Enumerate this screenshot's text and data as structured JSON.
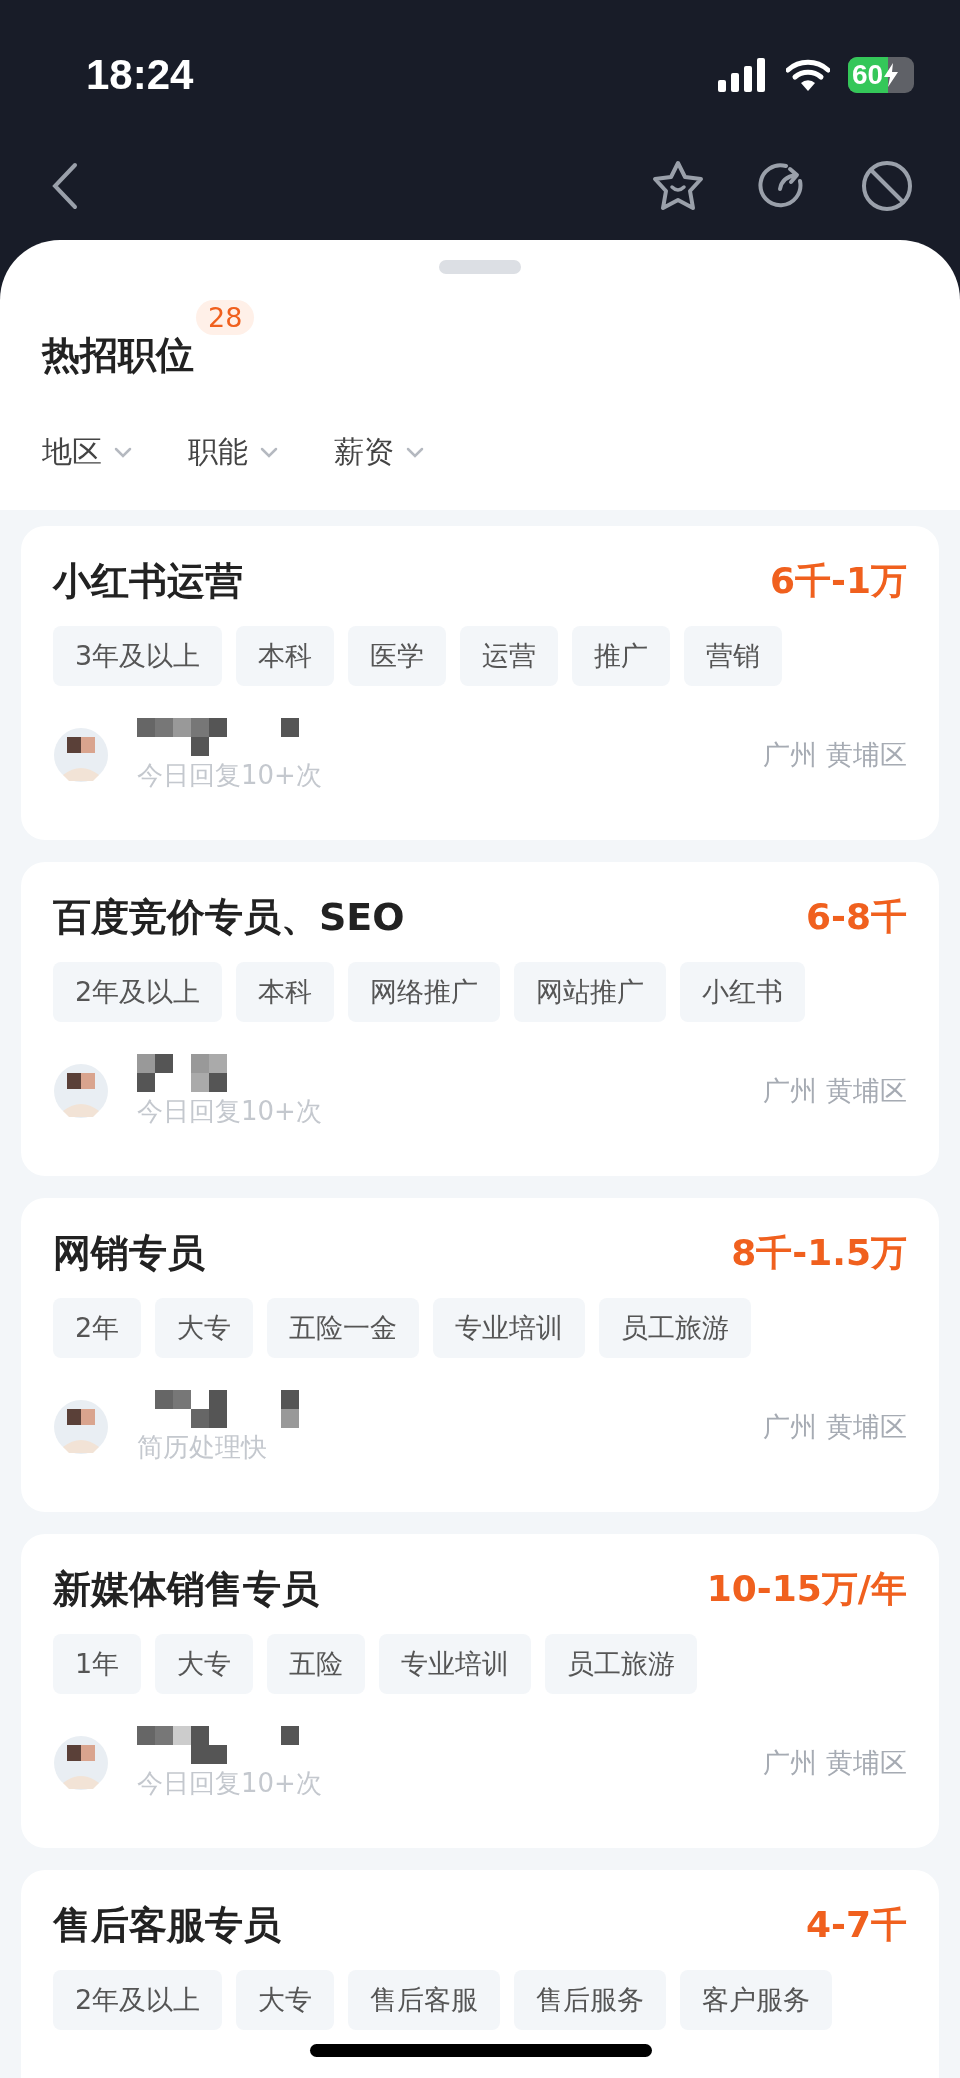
{
  "status_bar": {
    "time": "18:24",
    "battery": "60"
  },
  "header": {
    "title": "热招职位",
    "count": "28"
  },
  "filters": [
    {
      "label": "地区"
    },
    {
      "label": "职能"
    },
    {
      "label": "薪资"
    }
  ],
  "jobs": [
    {
      "title": "小红书运营",
      "salary": "6千-1万",
      "tags": [
        "3年及以上",
        "本科",
        "医学",
        "运营",
        "推广",
        "营销"
      ],
      "note": "今日回复10+次",
      "location": "广州 黄埔区"
    },
    {
      "title": "百度竞价专员、SEO",
      "salary": "6-8千",
      "tags": [
        "2年及以上",
        "本科",
        "网络推广",
        "网站推广",
        "小红书"
      ],
      "note": "今日回复10+次",
      "location": "广州 黄埔区"
    },
    {
      "title": "网销专员",
      "salary": "8千-1.5万",
      "tags": [
        "2年",
        "大专",
        "五险一金",
        "专业培训",
        "员工旅游"
      ],
      "note": "简历处理快",
      "location": "广州 黄埔区"
    },
    {
      "title": "新媒体销售专员",
      "salary": "10-15万/年",
      "tags": [
        "1年",
        "大专",
        "五险",
        "专业培训",
        "员工旅游"
      ],
      "note": "今日回复10+次",
      "location": "广州 黄埔区"
    },
    {
      "title": "售后客服专员",
      "salary": "4-7千",
      "tags": [
        "2年及以上",
        "大专",
        "售后客服",
        "售后服务",
        "客户服务"
      ]
    }
  ]
}
